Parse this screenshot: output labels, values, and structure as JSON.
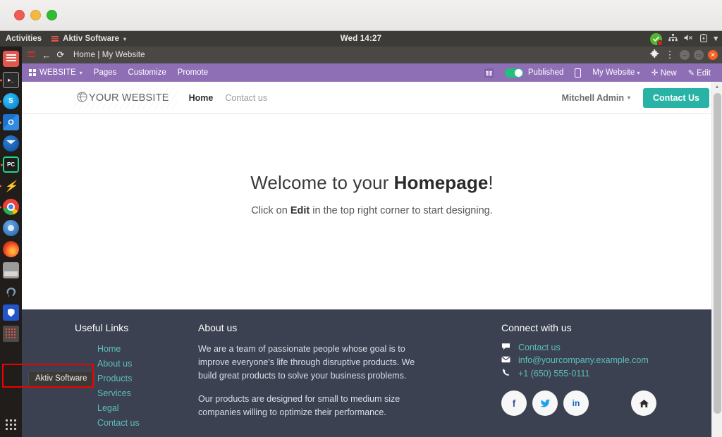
{
  "window": {
    "controls": [
      "close",
      "minimize",
      "maximize"
    ]
  },
  "gnome": {
    "activities": "Activities",
    "app_menu": "Aktiv Software",
    "app_menu_caret": "▾",
    "clock": "Wed 14:27",
    "tray": [
      {
        "name": "sync-check-icon",
        "glyph": "✓"
      },
      {
        "name": "network-icon",
        "glyph": "⤬"
      },
      {
        "name": "volume-muted-icon",
        "glyph": "🔇"
      },
      {
        "name": "battery-icon",
        "glyph": "▮"
      },
      {
        "name": "system-menu-caret-icon",
        "glyph": "▾"
      }
    ]
  },
  "dock": {
    "items": [
      {
        "name": "odoo",
        "label": "Odoo",
        "running": false
      },
      {
        "name": "terminal",
        "label": "Terminal",
        "glyph": "▶_",
        "running": true
      },
      {
        "name": "skype",
        "label": "Skype",
        "glyph": "S",
        "running": true
      },
      {
        "name": "outlook",
        "label": "Outlook",
        "glyph": "O",
        "running": true
      },
      {
        "name": "thunderbird",
        "label": "Thunderbird",
        "running": false
      },
      {
        "name": "pycharm",
        "label": "PyCharm",
        "glyph": "PC",
        "running": true
      },
      {
        "name": "sublime-text",
        "label": "Sublime Text",
        "glyph": "⚡",
        "running": true
      },
      {
        "name": "chrome",
        "label": "Google Chrome",
        "running": true
      },
      {
        "name": "chromium",
        "label": "Chromium",
        "running": false
      },
      {
        "name": "firefox",
        "label": "Firefox",
        "running": false
      },
      {
        "name": "files",
        "label": "Files",
        "running": true
      },
      {
        "name": "postgresql",
        "label": "PostgreSQL",
        "glyph": "🐘",
        "running": false
      },
      {
        "name": "bitwarden",
        "label": "Bitwarden",
        "running": false
      },
      {
        "name": "aktiv-software",
        "label": "Aktiv Software",
        "running": false
      }
    ],
    "tooltip": "Aktiv Software",
    "show_apps_label": "Show Applications"
  },
  "browser": {
    "back_glyph": "←",
    "reload_glyph": "⟳",
    "tab_title": "Home | My Website",
    "extensions_glyph": "🧩",
    "menu_glyph": "⋮",
    "minimize_glyph": "–",
    "maximize_glyph": "▭",
    "close_glyph": "✕"
  },
  "odoo_bar": {
    "brand": "WEBSITE",
    "brand_caret": "▾",
    "menu": [
      {
        "label": "Pages"
      },
      {
        "label": "Customize"
      },
      {
        "label": "Promote"
      }
    ],
    "gift_glyph": "🎁",
    "publish_label": "Published",
    "publish_state": "on",
    "mobile_preview_name": "mobile-preview-icon",
    "site_selector": "My Website",
    "site_selector_caret": "▾",
    "new_label": "New",
    "new_glyph": "✛",
    "edit_label": "Edit",
    "edit_glyph": "✎",
    "accent_color": "#8e6eb5"
  },
  "site": {
    "logo_text": "YOUR WEBSITE",
    "logo_icon": "globe-icon",
    "nav": [
      {
        "label": "Home",
        "active": true
      },
      {
        "label": "Contact us",
        "active": false
      }
    ],
    "user_menu": "Mitchell Admin",
    "user_menu_caret": "▾",
    "cta_label": "Contact Us",
    "cta_color": "#29b3a6",
    "hero": {
      "title_prefix": "Welcome to your ",
      "title_bold": "Homepage",
      "title_suffix": "!",
      "subtitle_prefix": "Click on ",
      "subtitle_bold": "Edit",
      "subtitle_suffix": " in the top right corner to start designing."
    },
    "footer": {
      "links_heading": "Useful Links",
      "links": [
        {
          "label": "Home"
        },
        {
          "label": "About us"
        },
        {
          "label": "Products"
        },
        {
          "label": "Services"
        },
        {
          "label": "Legal"
        },
        {
          "label": "Contact us"
        }
      ],
      "about_heading": "About us",
      "about_paragraph_1": "We are a team of passionate people whose goal is to improve everyone's life through disruptive products. We build great products to solve your business problems.",
      "about_paragraph_2": "Our products are designed for small to medium size companies willing to optimize their performance.",
      "connect_heading": "Connect with us",
      "contacts": [
        {
          "icon": "chat-icon",
          "glyph": "💬",
          "label": "Contact us"
        },
        {
          "icon": "envelope-icon",
          "glyph": "✉",
          "label": "info@yourcompany.example.com"
        },
        {
          "icon": "phone-icon",
          "glyph": "📞",
          "label": "+1 (650) 555-0111"
        }
      ],
      "socials": [
        {
          "name": "facebook-icon",
          "glyph": "f"
        },
        {
          "name": "twitter-icon",
          "glyph": "🐦"
        },
        {
          "name": "linkedin-icon",
          "glyph": "in"
        },
        {
          "name": "home-icon",
          "glyph": "⌂"
        }
      ],
      "background_color": "#3c4152",
      "link_color": "#5cbfb8"
    }
  },
  "scrollbar": {
    "up_arrow": "▲"
  },
  "annotation": {
    "highlight_color": "#ef0000",
    "target": "aktiv-software-dock-item"
  }
}
